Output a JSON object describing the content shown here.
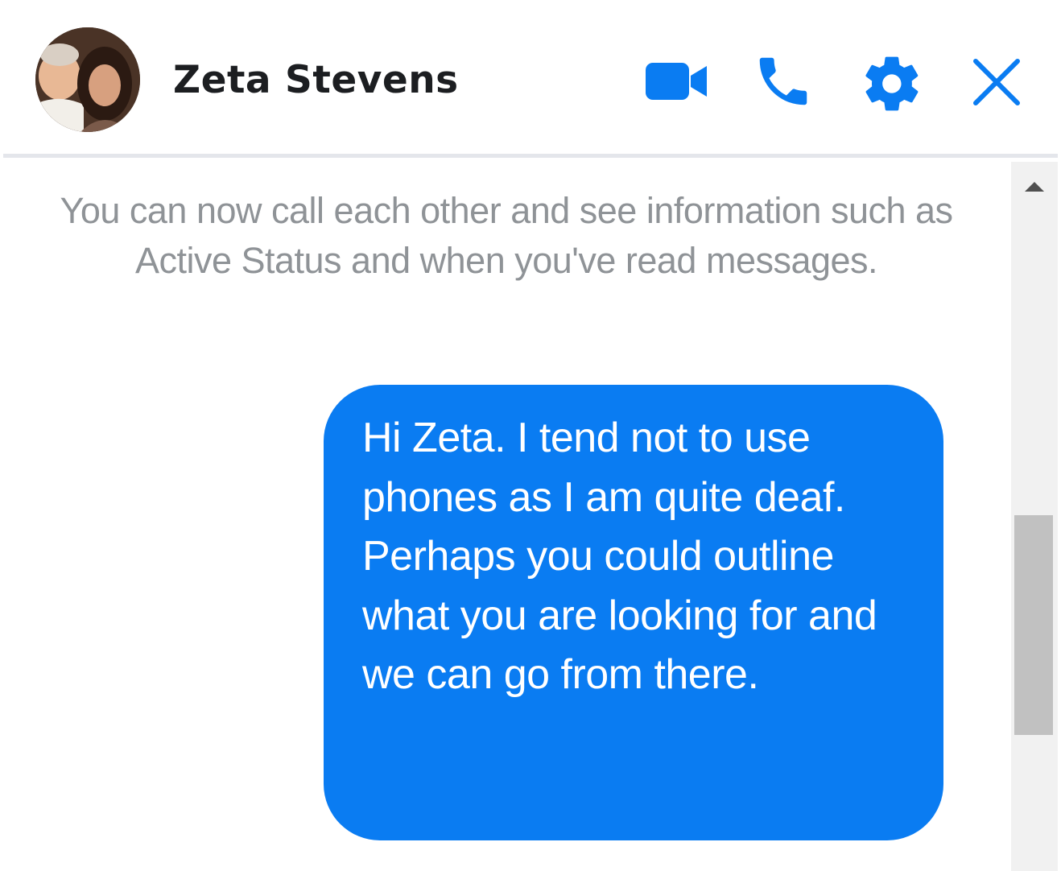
{
  "header": {
    "contact_name": "Zeta Stevens",
    "icons": {
      "video": "video-camera-icon",
      "phone": "phone-icon",
      "settings": "gear-icon",
      "close": "close-icon"
    }
  },
  "conversation": {
    "system_notice": "You can now call each other and see information such as Active Status and when you've read messages.",
    "messages": [
      {
        "direction": "outgoing",
        "text": "Hi Zeta. I tend not to use phones as I am quite deaf.\nPerhaps you could outline what you are looking for and we can go from there."
      }
    ]
  },
  "colors": {
    "accent": "#0a7cf2",
    "system_text": "#8f9397",
    "name_text": "#1c1e21"
  }
}
